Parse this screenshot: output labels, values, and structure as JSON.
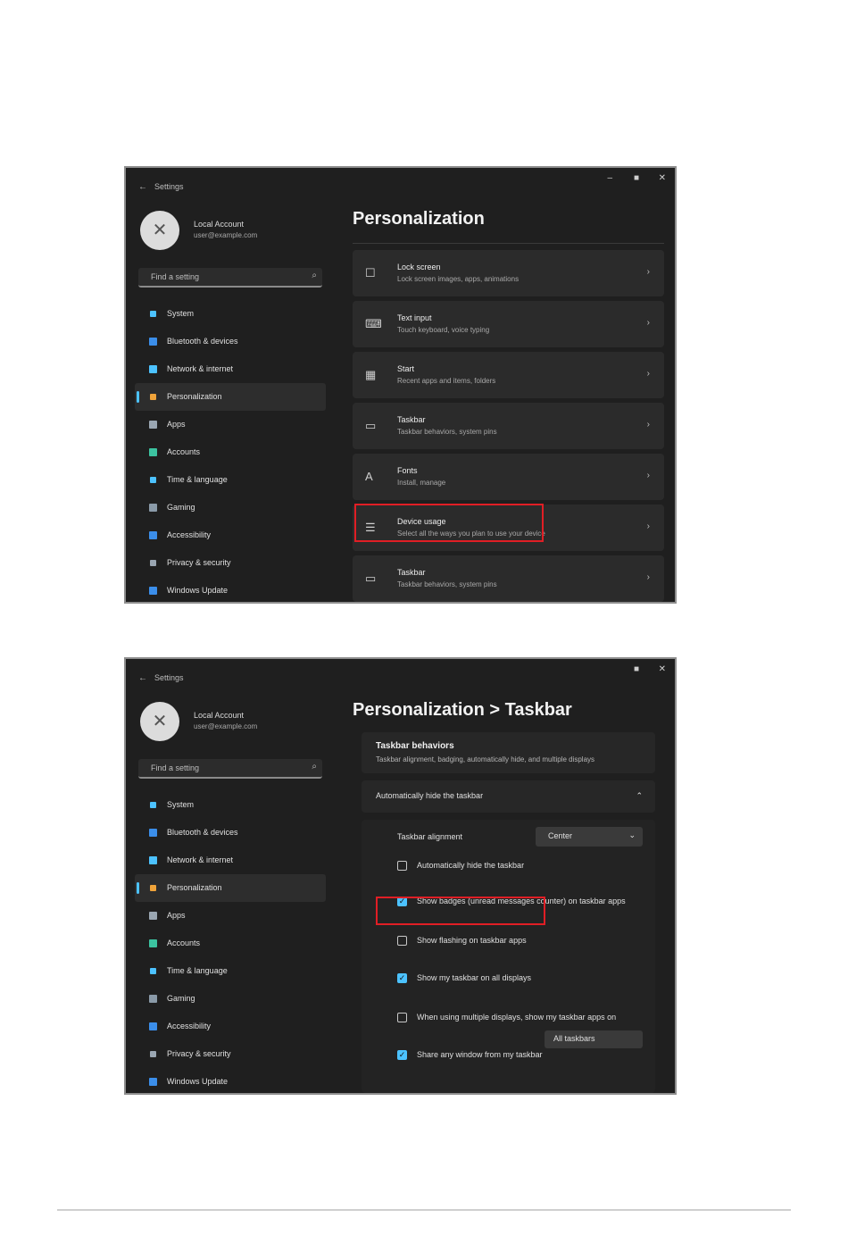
{
  "colors": {
    "accent": "#4cc2ff",
    "highlight": "#e01e25",
    "panel": "#1f1f1f",
    "card": "#2b2b2b"
  },
  "window": {
    "title": "Settings",
    "back_icon": "back-arrow-icon"
  },
  "user": {
    "name": "Local Account",
    "email": "user@example.com"
  },
  "search": {
    "placeholder": "Find a setting"
  },
  "nav": [
    {
      "label": "System",
      "color": "#4cc2ff"
    },
    {
      "label": "Bluetooth & devices",
      "color": "#3b8eea"
    },
    {
      "label": "Network & internet",
      "color": "#4cc2ff"
    },
    {
      "label": "Personalization",
      "color": "#f0a33a",
      "active": true
    },
    {
      "label": "Apps",
      "color": "#9aa6b2"
    },
    {
      "label": "Accounts",
      "color": "#3cc3a0"
    },
    {
      "label": "Time & language",
      "color": "#4cc2ff"
    },
    {
      "label": "Gaming",
      "color": "#8a9aa8"
    },
    {
      "label": "Accessibility",
      "color": "#3b8eea"
    },
    {
      "label": "Privacy & security",
      "color": "#9aa6b2"
    },
    {
      "label": "Windows Update",
      "color": "#3b8eea"
    }
  ],
  "screen1": {
    "title": "Personalization",
    "cards": [
      {
        "title": "Lock screen",
        "desc": "Lock screen images, apps, animations",
        "icon": "lock-screen-icon"
      },
      {
        "title": "Text input",
        "desc": "Touch keyboard, voice typing",
        "icon": "keyboard-icon"
      },
      {
        "title": "Start",
        "desc": "Recent apps and items, folders",
        "icon": "start-icon"
      },
      {
        "title": "Taskbar",
        "desc": "Taskbar behaviors, system pins",
        "icon": "taskbar-icon"
      },
      {
        "title": "Fonts",
        "desc": "Install, manage",
        "icon": "fonts-icon"
      },
      {
        "title": "Device usage",
        "desc": "Select all the ways you plan to use your device",
        "icon": "device-usage-icon"
      },
      {
        "title": "Taskbar",
        "desc": "Taskbar behaviors, system pins",
        "icon": "taskbar-icon"
      }
    ]
  },
  "screen2": {
    "title": "Personalization  >  Taskbar",
    "section_title": "Taskbar behaviors",
    "section_desc": "Taskbar alignment, badging, automatically hide, and multiple displays",
    "row_label": "Automatically hide the taskbar",
    "alignment_label": "Taskbar alignment",
    "alignment_value": "Center",
    "options": [
      {
        "label": "Automatically hide the taskbar",
        "checked": false
      },
      {
        "label": "Show badges (unread messages counter) on taskbar apps",
        "checked": true
      },
      {
        "label": "Show flashing on taskbar apps",
        "checked": false
      },
      {
        "label": "Show my taskbar on all displays",
        "checked": true
      },
      {
        "label": "When using multiple displays, show my taskbar apps on",
        "checked": false
      },
      {
        "label": "Share any window from my taskbar",
        "checked": true
      }
    ],
    "multi_display_value": "All taskbars"
  }
}
